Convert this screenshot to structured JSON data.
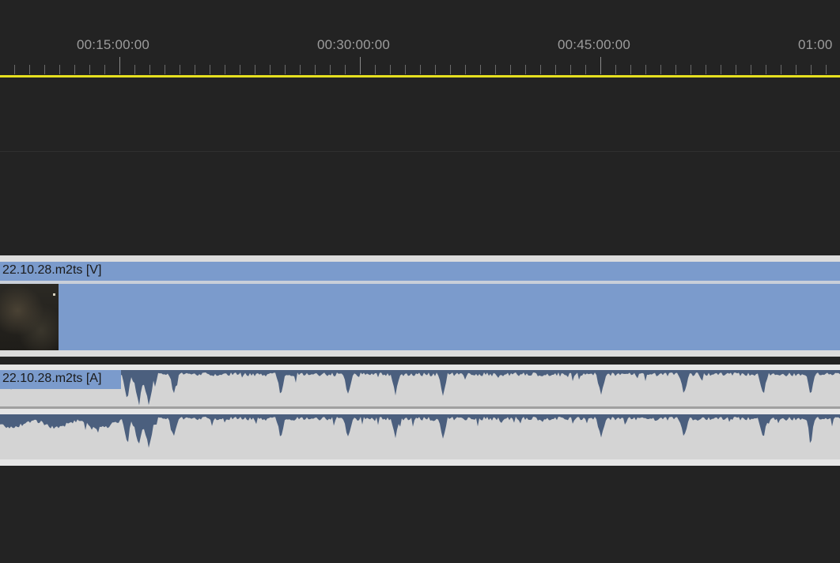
{
  "ruler": {
    "timecodes": [
      "00:15:00:00",
      "00:30:00:00",
      "00:45:00:00",
      "01:00"
    ],
    "work_area_color": "#e6e020"
  },
  "video_track": {
    "clip_name": "22.10.28.m2ts [V]",
    "clip_color": "#7b9bcc"
  },
  "audio_track": {
    "clip_name": "22.10.28.m2ts [A]",
    "clip_color": "#7b9bcc",
    "waveform_color": "#4b5f7e",
    "background_color": "#d4d4d4"
  }
}
